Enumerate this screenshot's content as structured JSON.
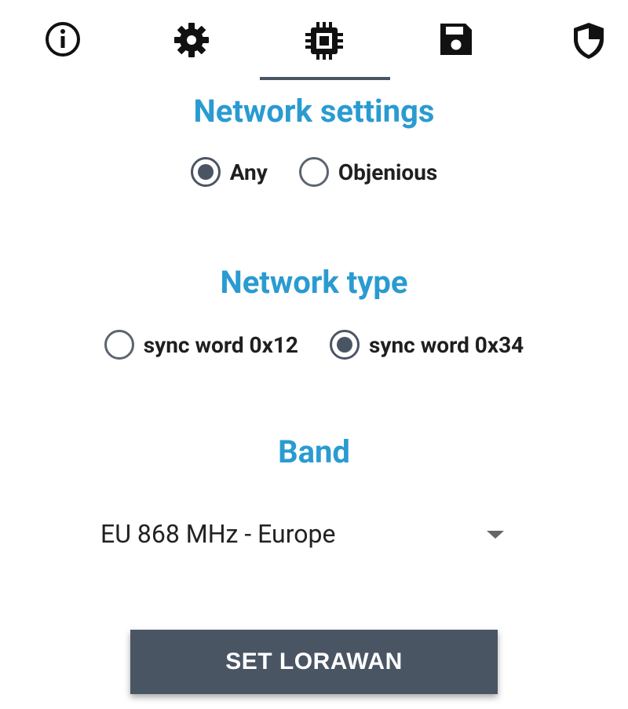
{
  "tabs": [
    {
      "id": "info",
      "icon": "info-icon"
    },
    {
      "id": "settings",
      "icon": "gear-icon"
    },
    {
      "id": "network",
      "icon": "chip-icon",
      "active": true
    },
    {
      "id": "storage",
      "icon": "floppy-disk-icon"
    },
    {
      "id": "security",
      "icon": "shield-icon"
    }
  ],
  "network_settings": {
    "title": "Network settings",
    "options": [
      {
        "label": "Any",
        "checked": true
      },
      {
        "label": "Objenious",
        "checked": false
      }
    ]
  },
  "network_type": {
    "title": "Network type",
    "options": [
      {
        "label": "sync word 0x12",
        "checked": false
      },
      {
        "label": "sync word 0x34",
        "checked": true
      }
    ]
  },
  "band": {
    "title": "Band",
    "selected": "EU 868 MHz - Europe"
  },
  "actions": {
    "submit_label": "SET LORAWAN"
  },
  "colors": {
    "accent": "#2a9bd1",
    "primary": "#4a5564",
    "text": "#1f1f1f"
  }
}
